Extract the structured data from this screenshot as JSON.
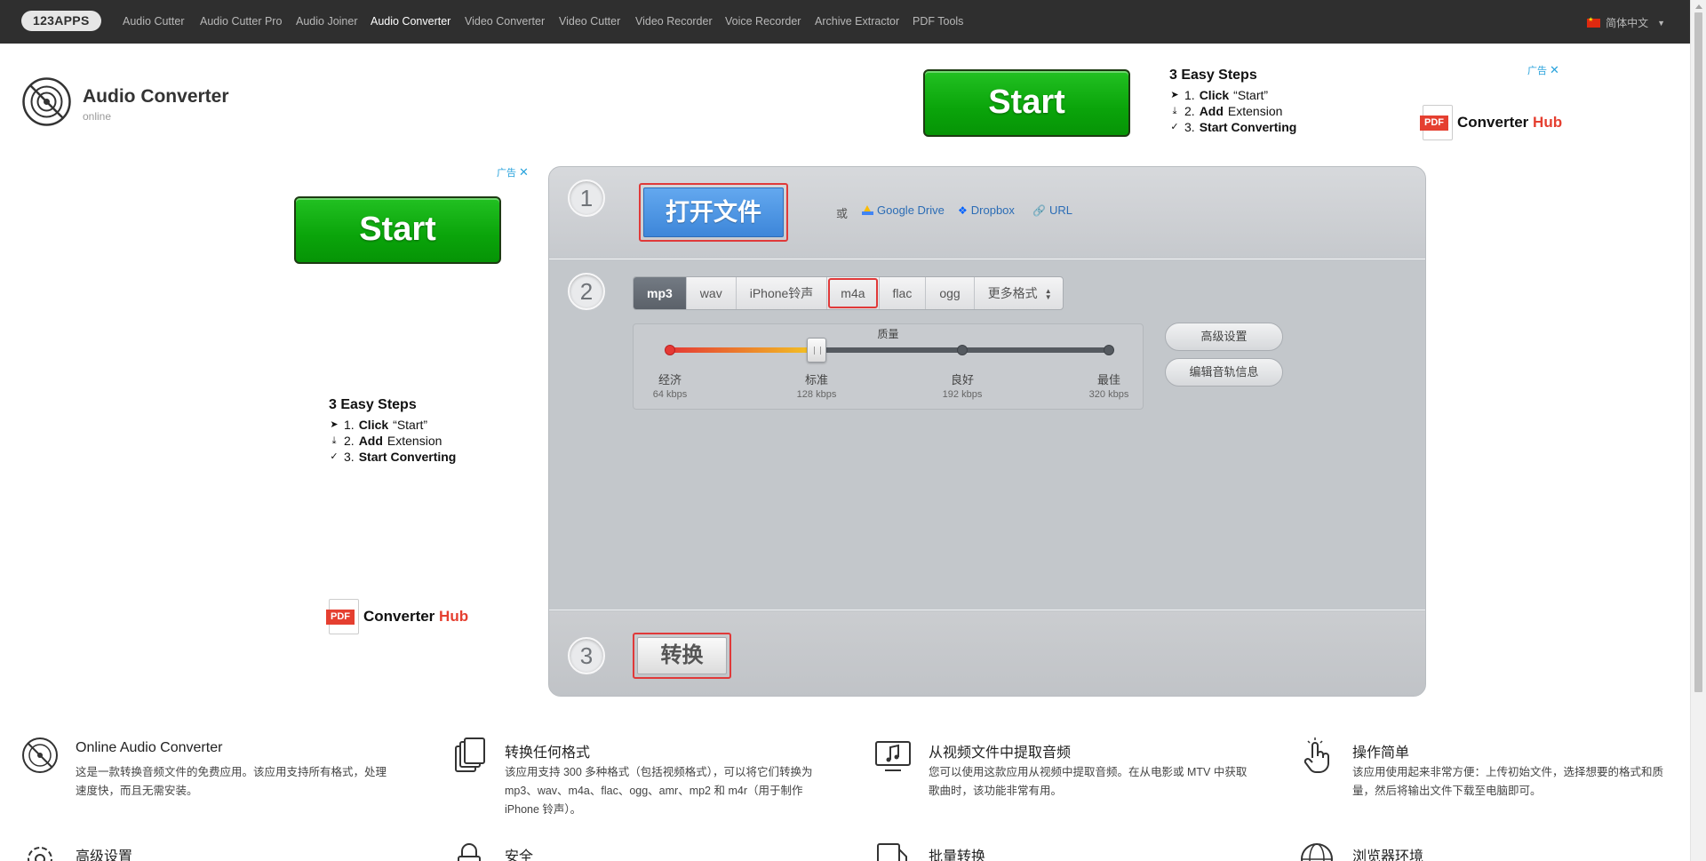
{
  "nav": {
    "brand": "123APPS",
    "items": [
      "Audio Cutter",
      "Audio Cutter Pro",
      "Audio Joiner",
      "Audio Converter",
      "Video Converter",
      "Video Cutter",
      "Video Recorder",
      "Voice Recorder",
      "Archive Extractor",
      "PDF Tools"
    ],
    "active": "Audio Converter",
    "language": "简体中文"
  },
  "header": {
    "title": "Audio Converter",
    "subtitle": "online"
  },
  "ads": {
    "start_label": "Start",
    "steps_title": "3 Easy Steps",
    "step1_prefix": "1.",
    "step1_bold": "Click",
    "step1_rest": "“Start”",
    "step2_prefix": "2.",
    "step2_bold": "Add",
    "step2_rest": "Extension",
    "step3_prefix": "3.",
    "step3_bold": "Start Converting",
    "badge": "广告",
    "hub_pdf": "PDF",
    "hub_name": "Converter",
    "hub_accent": "Hub"
  },
  "converter": {
    "step1": "1",
    "step2": "2",
    "step3": "3",
    "open_file": "打开文件",
    "or": "或",
    "google_drive": "Google Drive",
    "dropbox": "Dropbox",
    "url": "URL",
    "formats": [
      "mp3",
      "wav",
      "iPhone铃声",
      "m4a",
      "flac",
      "ogg",
      "更多格式"
    ],
    "selected_format": "mp3",
    "highlighted_format": "m4a",
    "quality_title": "质量",
    "quality_levels": [
      {
        "label": "经济",
        "kbps": "64 kbps"
      },
      {
        "label": "标准",
        "kbps": "128 kbps"
      },
      {
        "label": "良好",
        "kbps": "192 kbps"
      },
      {
        "label": "最佳",
        "kbps": "320 kbps"
      }
    ],
    "quality_selected_index": 1,
    "advanced_settings": "高级设置",
    "edit_track_info": "编辑音轨信息",
    "convert": "转换"
  },
  "features": [
    {
      "icon": "disc-icon",
      "title": "Online Audio Converter",
      "desc": "这是一款转换音频文件的免费应用。该应用支持所有格式，处理速度快，而且无需安装。"
    },
    {
      "icon": "files-icon",
      "title": "转换任何格式",
      "desc": "该应用支持 300 多种格式（包括视频格式），可以将它们转换为 mp3、wav、m4a、flac、ogg、amr、mp2 和 m4r（用于制作 iPhone 铃声）。"
    },
    {
      "icon": "video-music-icon",
      "title": "从视频文件中提取音频",
      "desc": "您可以使用这款应用从视频中提取音频。在从电影或 MTV 中获取歌曲时，该功能非常有用。"
    },
    {
      "icon": "hand-pointer-icon",
      "title": "操作简单",
      "desc": "该应用使用起来非常方便：上传初始文件，选择想要的格式和质量，然后将输出文件下载至电脑即可。"
    },
    {
      "icon": "gear-icon",
      "title": "高级设置",
      "desc": ""
    },
    {
      "icon": "lock-icon",
      "title": "安全",
      "desc": ""
    },
    {
      "icon": "batch-icon",
      "title": "批量转换",
      "desc": ""
    },
    {
      "icon": "globe-icon",
      "title": "浏览器环境",
      "desc": ""
    }
  ]
}
